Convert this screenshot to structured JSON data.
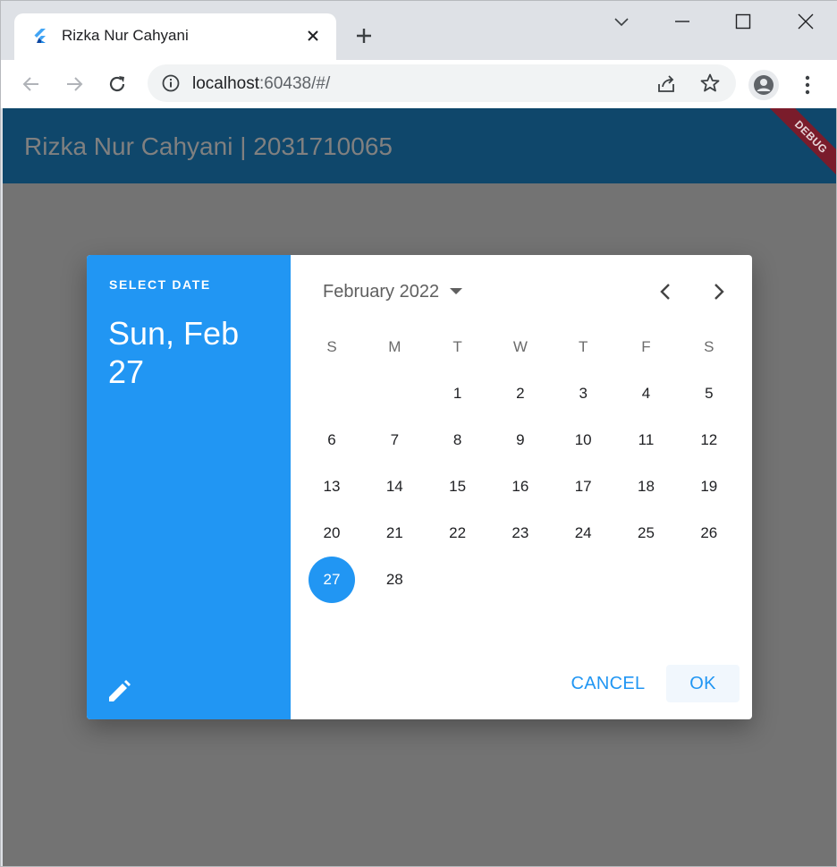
{
  "browser": {
    "tab_title": "Rizka Nur Cahyani",
    "url_host": "localhost",
    "url_rest": ":60438/#/"
  },
  "app": {
    "title": "Rizka Nur Cahyani | 2031710065",
    "debug_banner": "DEBUG",
    "appbar_color": "#0f476b"
  },
  "datepicker": {
    "help_text": "SELECT DATE",
    "selected_date": "Sun, Feb 27",
    "month_year": "February 2022",
    "weekdays": [
      "S",
      "M",
      "T",
      "W",
      "T",
      "F",
      "S"
    ],
    "first_weekday_index": 2,
    "days_in_month": 28,
    "selected_day": 27,
    "cancel_label": "CANCEL",
    "ok_label": "OK",
    "accent_color": "#2196f3"
  },
  "icons": {
    "favicon": "flutter-logo-icon",
    "tab_close": "close-icon",
    "new_tab": "plus-icon",
    "back": "arrow-left-icon",
    "forward": "arrow-right-icon",
    "reload": "reload-icon",
    "site_info": "info-icon",
    "share": "share-icon",
    "bookmark": "star-icon",
    "profile": "person-icon",
    "menu": "kebab-icon",
    "edit": "pencil-icon",
    "dropdown": "caret-down-icon",
    "prev_month": "chevron-left-icon",
    "next_month": "chevron-right-icon"
  }
}
